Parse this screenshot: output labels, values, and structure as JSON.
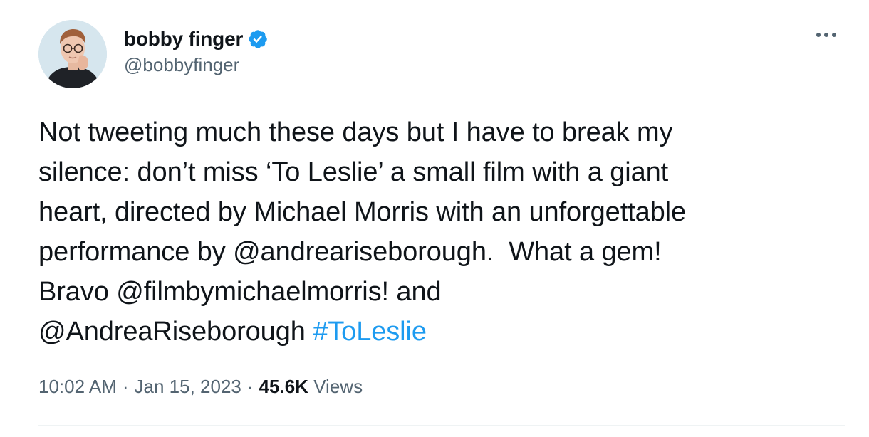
{
  "author": {
    "display_name": "bobby finger",
    "handle": "@bobbyfinger",
    "verified": true
  },
  "tweet": {
    "text": "Not tweeting much these days but I have to break my\nsilence: don’t miss ‘To Leslie’ a small film with a giant\nheart, directed by Michael Morris with an unforgettable\nperformance by @andreariseborough.  What a gem!\nBravo @filmbymichaelmorris! and\n@AndreaRiseborough ",
    "hashtag": "#ToLeslie"
  },
  "meta": {
    "time": "10:02 AM",
    "separator": "·",
    "date": "Jan 15, 2023",
    "views_count": "45.6K",
    "views_label": "Views"
  },
  "colors": {
    "link": "#1d9bf0",
    "secondary_text": "#536471",
    "primary_text": "#0f1419",
    "divider": "#eff3f4"
  },
  "icons": {
    "verified": "verified-badge-icon",
    "more": "more-options-icon"
  }
}
